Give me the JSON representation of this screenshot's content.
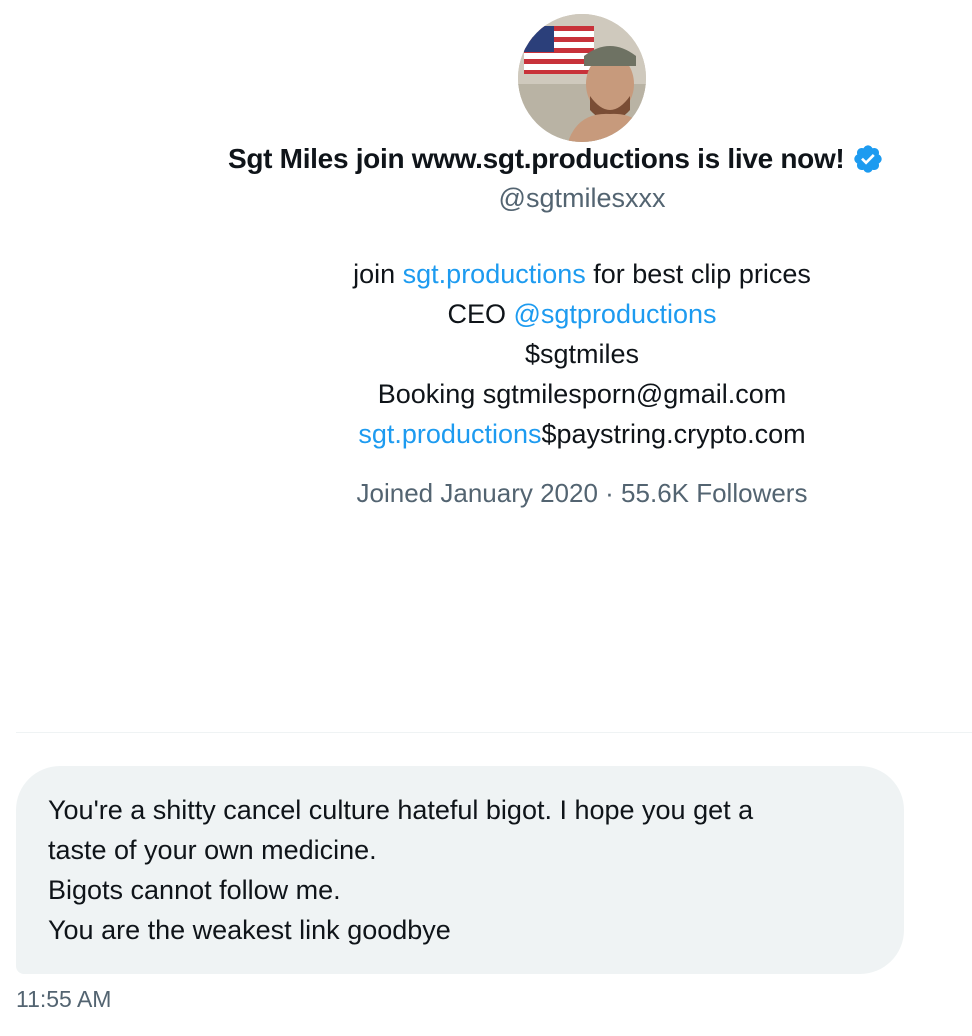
{
  "profile": {
    "display_name": "Sgt Miles join www.sgt.productions is live now!",
    "verified_icon": "verified-badge-icon",
    "handle": "@sgtmilesxxx",
    "bio": {
      "line1_prefix": "join ",
      "line1_link": "sgt.productions",
      "line1_suffix": " for best clip prices",
      "line2_prefix": "CEO ",
      "line2_link": "@sgtproductions",
      "line3": "$sgtmiles",
      "line4": "Booking sgtmilesporn@gmail.com",
      "line5_link": "sgt.productions",
      "line5_suffix": "$paystring.crypto.com"
    },
    "joined": "Joined January 2020",
    "separator": "·",
    "followers": "55.6K Followers"
  },
  "message": {
    "lines": [
      "You're a shitty cancel culture hateful bigot.  I hope you get a",
      "taste of your own medicine.",
      "Bigots cannot follow me.",
      "You are the weakest link goodbye"
    ],
    "timestamp": "11:55 AM"
  },
  "colors": {
    "link": "#1d9bf0",
    "secondary_text": "#536471",
    "bubble_bg": "#eff3f4",
    "verified": "#1d9bf0"
  }
}
